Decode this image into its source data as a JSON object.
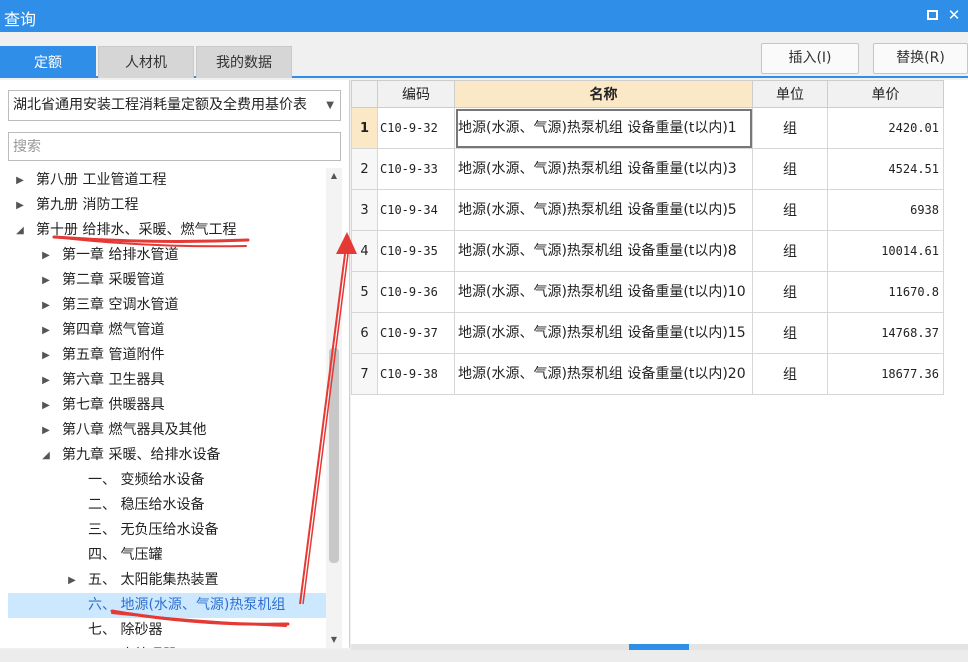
{
  "window": {
    "title": "查询"
  },
  "tabs": [
    {
      "label": "定额",
      "active": true
    },
    {
      "label": "人材机",
      "active": false
    },
    {
      "label": "我的数据",
      "active": false
    }
  ],
  "toolbar": {
    "insert_label": "插入(I)",
    "replace_label": "替换(R)"
  },
  "library": {
    "selected": "湖北省通用安装工程消耗量定额及全费用基价表"
  },
  "search": {
    "placeholder": "搜索"
  },
  "tree": [
    {
      "label": "第八册 工业管道工程",
      "level": 0,
      "toggle": "▶"
    },
    {
      "label": "第九册 消防工程",
      "level": 0,
      "toggle": "▶"
    },
    {
      "label": "第十册 给排水、采暖、燃气工程",
      "level": 0,
      "toggle": "◢"
    },
    {
      "label": "第一章 给排水管道",
      "level": 1,
      "toggle": "▶"
    },
    {
      "label": "第二章 采暖管道",
      "level": 1,
      "toggle": "▶"
    },
    {
      "label": "第三章 空调水管道",
      "level": 1,
      "toggle": "▶"
    },
    {
      "label": "第四章 燃气管道",
      "level": 1,
      "toggle": "▶"
    },
    {
      "label": "第五章 管道附件",
      "level": 1,
      "toggle": "▶"
    },
    {
      "label": "第六章 卫生器具",
      "level": 1,
      "toggle": "▶"
    },
    {
      "label": "第七章 供暖器具",
      "level": 1,
      "toggle": "▶"
    },
    {
      "label": "第八章 燃气器具及其他",
      "level": 1,
      "toggle": "▶"
    },
    {
      "label": "第九章 采暖、给排水设备",
      "level": 1,
      "toggle": "◢"
    },
    {
      "label": "一、 变频给水设备",
      "level": 2,
      "toggle": ""
    },
    {
      "label": "二、 稳压给水设备",
      "level": 2,
      "toggle": ""
    },
    {
      "label": "三、 无负压给水设备",
      "level": 2,
      "toggle": ""
    },
    {
      "label": "四、 气压罐",
      "level": 2,
      "toggle": ""
    },
    {
      "label": "五、 太阳能集热装置",
      "level": 2,
      "toggle": "▶"
    },
    {
      "label": "六、 地源(水源、气源)热泵机组",
      "level": 2,
      "toggle": "",
      "selected": true
    },
    {
      "label": "七、 除砂器",
      "level": 2,
      "toggle": ""
    },
    {
      "label": "八、 水处理器",
      "level": 2,
      "toggle": ""
    }
  ],
  "table": {
    "headers": {
      "code": "编码",
      "name": "名称",
      "unit": "单位",
      "price": "单价"
    },
    "rows": [
      {
        "no": "1",
        "code": "C10-9-32",
        "name": "地源(水源、气源)热泵机组 设备重量(t以内)1",
        "unit": "组",
        "price": "2420.01"
      },
      {
        "no": "2",
        "code": "C10-9-33",
        "name": "地源(水源、气源)热泵机组 设备重量(t以内)3",
        "unit": "组",
        "price": "4524.51"
      },
      {
        "no": "3",
        "code": "C10-9-34",
        "name": "地源(水源、气源)热泵机组 设备重量(t以内)5",
        "unit": "组",
        "price": "6938"
      },
      {
        "no": "4",
        "code": "C10-9-35",
        "name": "地源(水源、气源)热泵机组 设备重量(t以内)8",
        "unit": "组",
        "price": "10014.61"
      },
      {
        "no": "5",
        "code": "C10-9-36",
        "name": "地源(水源、气源)热泵机组 设备重量(t以内)10",
        "unit": "组",
        "price": "11670.8"
      },
      {
        "no": "6",
        "code": "C10-9-37",
        "name": "地源(水源、气源)热泵机组 设备重量(t以内)15",
        "unit": "组",
        "price": "14768.37"
      },
      {
        "no": "7",
        "code": "C10-9-38",
        "name": "地源(水源、气源)热泵机组 设备重量(t以内)20",
        "unit": "组",
        "price": "18677.36"
      }
    ]
  },
  "colors": {
    "accent": "#2f8ee8",
    "header_highlight": "#fbe8c6",
    "selection": "#cce8ff",
    "annotation": "#e53935"
  }
}
